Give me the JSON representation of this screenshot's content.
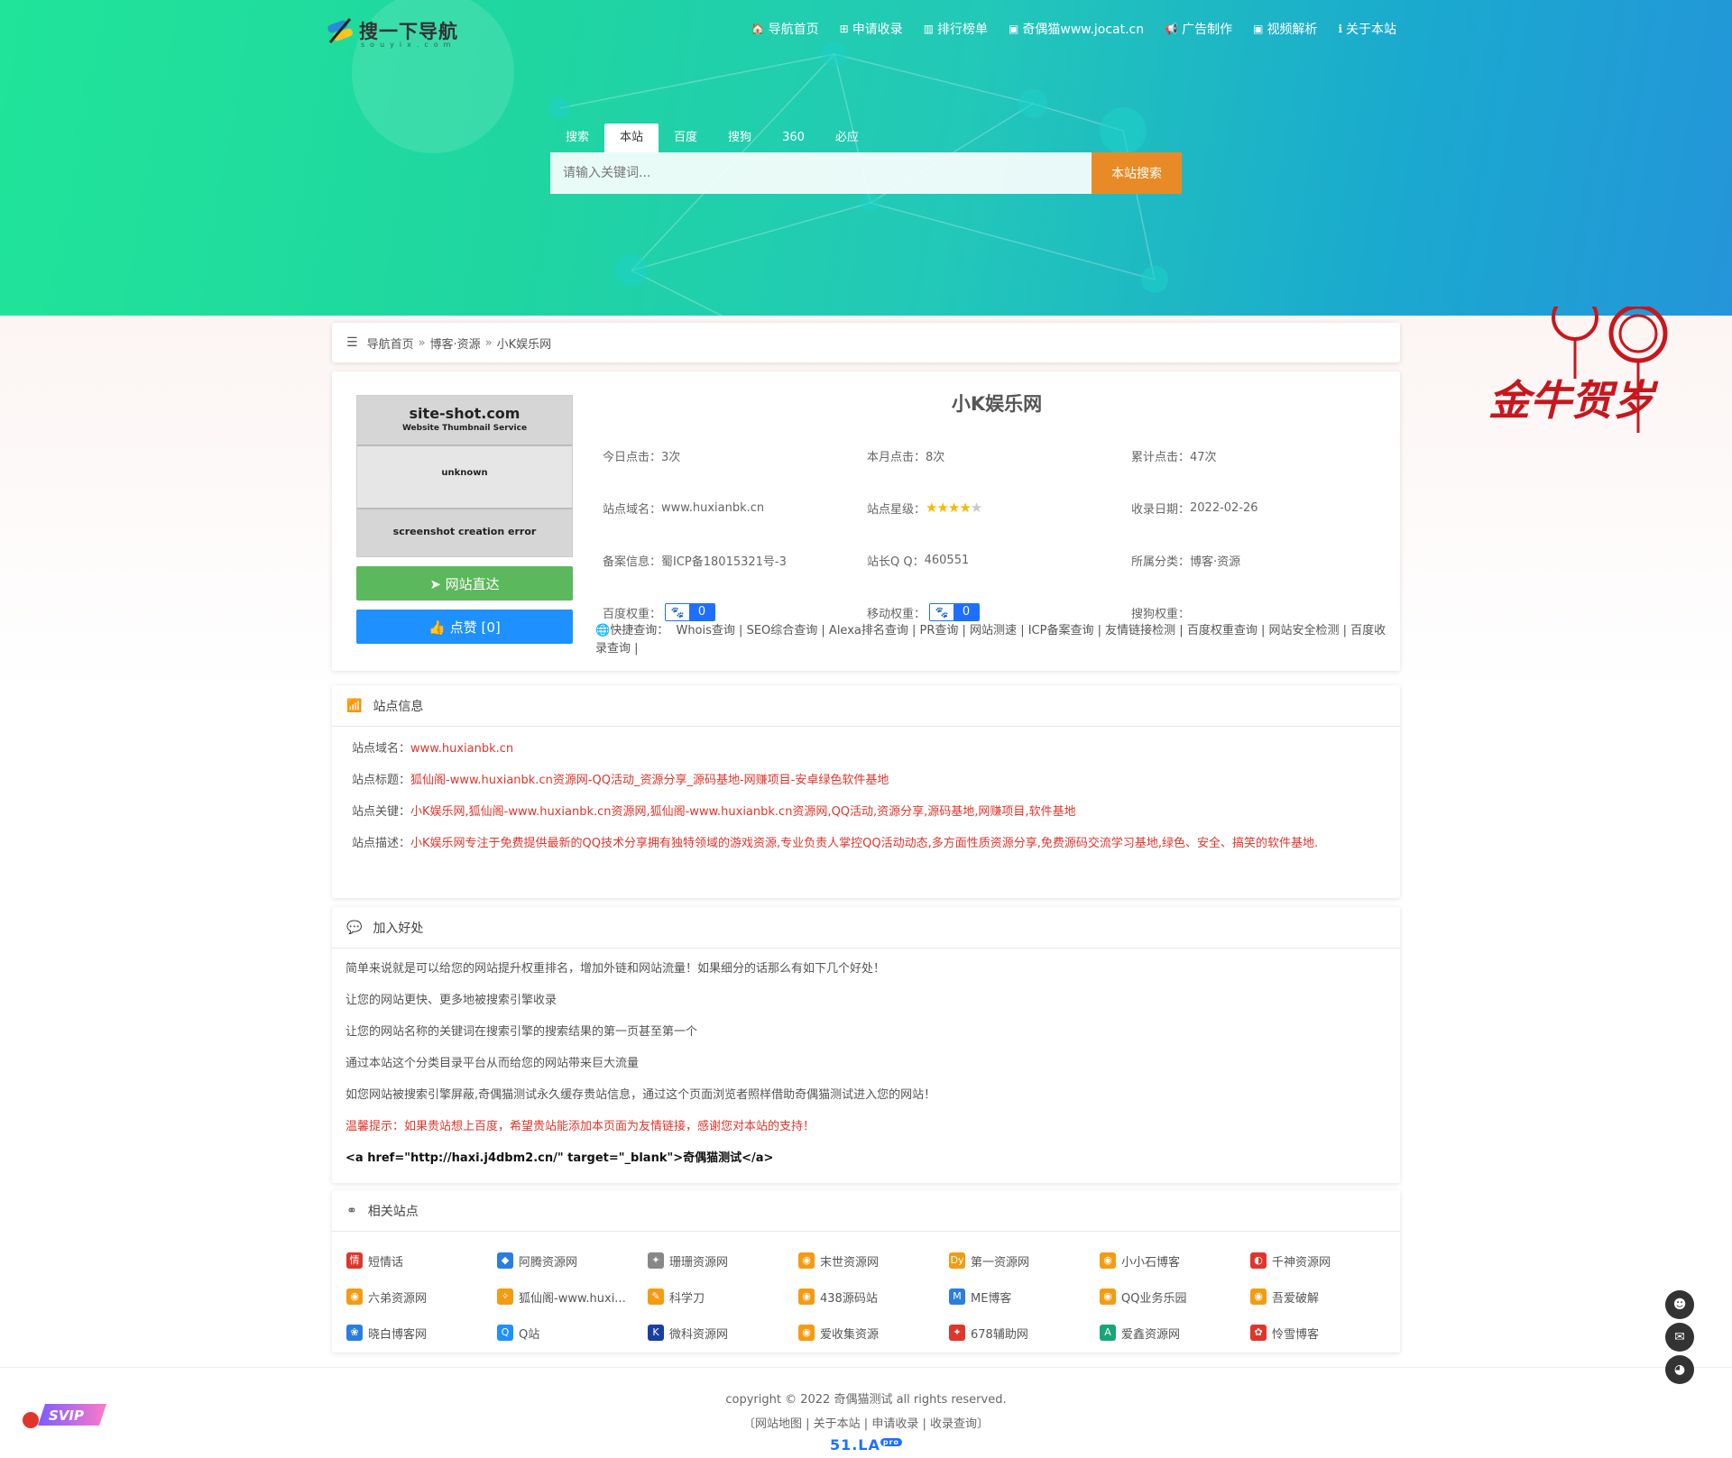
{
  "logo": {
    "text": "搜一下导航",
    "sub": "souyix.com"
  },
  "nav": [
    {
      "icon": "🏠",
      "label": "导航首页"
    },
    {
      "icon": "⊞",
      "label": "申请收录"
    },
    {
      "icon": "▥",
      "label": "排行榜单"
    },
    {
      "icon": "▣",
      "label": "奇偶猫www.jocat.cn"
    },
    {
      "icon": "📢",
      "label": "广告制作"
    },
    {
      "icon": "▣",
      "label": "视频解析"
    },
    {
      "icon": "ℹ",
      "label": "关于本站"
    }
  ],
  "search": {
    "tabs": [
      "搜索",
      "本站",
      "百度",
      "搜狗",
      "360",
      "必应"
    ],
    "active_tab": "本站",
    "placeholder": "请输入关键词...",
    "button": "本站搜索"
  },
  "breadcrumb": {
    "home": "导航首页",
    "category": "博客·资源",
    "current": "小K娱乐网",
    "sep": "»"
  },
  "thumbnail": {
    "title": "site-shot.com",
    "subtitle": "Website Thumbnail Service",
    "status": "unknown",
    "error": "screenshot creation error"
  },
  "buttons": {
    "visit": "网站直达",
    "like": "点赞 [0]"
  },
  "site": {
    "title": "小K娱乐网",
    "today_clicks_label": "今日点击：",
    "today_clicks": "3次",
    "month_clicks_label": "本月点击：",
    "month_clicks": "8次",
    "total_clicks_label": "累计点击：",
    "total_clicks": "47次",
    "domain_label": "站点域名：",
    "domain": "www.huxianbk.cn",
    "rating_label": "站点星级：",
    "rating": 4,
    "rating_max": 5,
    "date_label": "收录日期：",
    "date": "2022-02-26",
    "icp_label": "备案信息：",
    "icp": "蜀ICP备18015321号-3",
    "qq_label": "站长Q Q：",
    "qq": "460551",
    "category_label": "所属分类：",
    "category": "博客·资源",
    "baidu_weight_label": "百度权重：",
    "baidu_weight": "0",
    "mobile_weight_label": "移动权重：",
    "mobile_weight": "0",
    "sogou_weight_label": "搜狗权重："
  },
  "quick_query": {
    "label": "快捷查询：",
    "items": [
      "Whois查询",
      "SEO综合查询",
      "Alexa排名查询",
      "PR查询",
      "网站测速",
      "ICP备案查询",
      "友情链接检测",
      "百度权重查询",
      "网站安全检测",
      "百度收录查询"
    ]
  },
  "site_info": {
    "heading": "站点信息",
    "rows": [
      {
        "label": "站点域名：",
        "value": "www.huxianbk.cn"
      },
      {
        "label": "站点标题：",
        "value": "狐仙阁-www.huxianbk.cn资源网-QQ活动_资源分享_源码基地-网赚项目-安卓绿色软件基地"
      },
      {
        "label": "站点关键：",
        "value": "小K娱乐网,狐仙阁-www.huxianbk.cn资源网,狐仙阁-www.huxianbk.cn资源网,QQ活动,资源分享,源码基地,网赚项目,软件基地"
      },
      {
        "label": "站点描述：",
        "value": "小K娱乐网专注于免费提供最新的QQ技术分享拥有独特领域的游戏资源,专业负责人掌控QQ活动动态,多方面性质资源分享,免费源码交流学习基地,绿色、安全、搞笑的软件基地."
      }
    ]
  },
  "benefits": {
    "heading": "加入好处",
    "lines": [
      "简单来说就是可以给您的网站提升权重排名，增加外链和网站流量！如果细分的话那么有如下几个好处！",
      "让您的网站更快、更多地被搜索引擎收录",
      "让您的网站名称的关键词在搜索引擎的搜索结果的第一页甚至第一个",
      "通过本站这个分类目录平台从而给您的网站带来巨大流量",
      "如您网站被搜索引擎屏蔽,奇偶猫测试永久缓存贵站信息，通过这个页面浏览者照样借助奇偶猫测试进入您的网站！"
    ],
    "warning": "温馨提示：如果贵站想上百度，希望贵站能添加本页面为友情链接，感谢您对本站的支持！",
    "code": "<a href=\"http://haxi.j4dbm2.cn/\" target=\"_blank\">奇偶猫测试</a>"
  },
  "related": {
    "heading": "相关站点",
    "items": [
      {
        "name": "短情话",
        "color": "#e0352b",
        "glyph": "情"
      },
      {
        "name": "阿腾资源网",
        "color": "#2a7de1",
        "glyph": "◆"
      },
      {
        "name": "珊珊资源网",
        "color": "#888888",
        "glyph": "✦"
      },
      {
        "name": "末世资源网",
        "color": "#f39c12",
        "glyph": "◉"
      },
      {
        "name": "第一资源网",
        "color": "#f39c12",
        "glyph": "Dy"
      },
      {
        "name": "小小石博客",
        "color": "#f39c12",
        "glyph": "◉"
      },
      {
        "name": "千神资源网",
        "color": "#e0352b",
        "glyph": "◐"
      },
      {
        "name": "六弟资源网",
        "color": "#f39c12",
        "glyph": "◉"
      },
      {
        "name": "狐仙阁-www.huxi...",
        "color": "#f39c12",
        "glyph": "✧"
      },
      {
        "name": "科学刀",
        "color": "#f39c12",
        "glyph": "✎"
      },
      {
        "name": "438源码站",
        "color": "#f39c12",
        "glyph": "◉"
      },
      {
        "name": "ME博客",
        "color": "#2a7de1",
        "glyph": "M"
      },
      {
        "name": "QQ业务乐园",
        "color": "#f39c12",
        "glyph": "◉"
      },
      {
        "name": "吾爱破解",
        "color": "#f39c12",
        "glyph": "◉"
      },
      {
        "name": "晓白博客网",
        "color": "#2a7de1",
        "glyph": "❀"
      },
      {
        "name": "Q站",
        "color": "#1e90ff",
        "glyph": "Q"
      },
      {
        "name": "微科资源网",
        "color": "#1a3fa0",
        "glyph": "K"
      },
      {
        "name": "爱收集资源",
        "color": "#f39c12",
        "glyph": "◉"
      },
      {
        "name": "678辅助网",
        "color": "#e0352b",
        "glyph": "✦"
      },
      {
        "name": "爱鑫资源网",
        "color": "#18a57a",
        "glyph": "A"
      },
      {
        "name": "怜雪博客",
        "color": "#e0352b",
        "glyph": "✿"
      }
    ]
  },
  "footer": {
    "copyright": "copyright © 2022 奇偶猫测试 all rights reserved.",
    "links": [
      "网站地图",
      "关于本站",
      "申请收录",
      "收录查询"
    ],
    "badge": "51.LA",
    "badge_sup": "pro"
  },
  "float_buttons": [
    "qq-icon",
    "mail-icon",
    "wechat-icon"
  ],
  "vip_badge": "SVIP",
  "decor": {
    "new_year": "金牛贺岁"
  },
  "colors": {
    "accent_red": "#e0352b",
    "search_btn": "#e88b26",
    "visit_btn": "#5cb85c",
    "like_btn": "#1e90ff"
  }
}
